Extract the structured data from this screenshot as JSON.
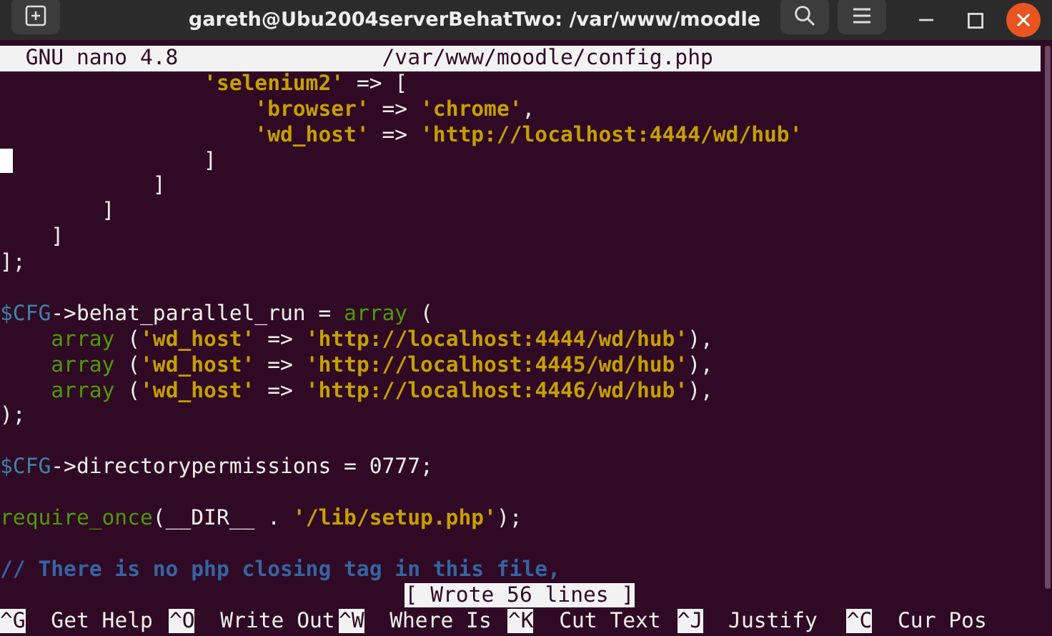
{
  "window": {
    "title": "gareth@Ubu2004serverBehatTwo: /var/www/moodle"
  },
  "nano_header": {
    "app": "GNU nano 4.8",
    "file": "/var/www/moodle/config.php"
  },
  "lines": [
    {
      "kind": "code",
      "cursor": false,
      "tokens": [
        {
          "text": "                'selenium2'",
          "kind": "string"
        },
        {
          "text": " => [",
          "kind": "plain"
        }
      ]
    },
    {
      "kind": "code",
      "cursor": false,
      "tokens": [
        {
          "text": "                    'browser'",
          "kind": "string"
        },
        {
          "text": " => ",
          "kind": "plain"
        },
        {
          "text": "'chrome'",
          "kind": "string"
        },
        {
          "text": ",",
          "kind": "plain"
        }
      ]
    },
    {
      "kind": "code",
      "cursor": false,
      "tokens": [
        {
          "text": "                    'wd_host'",
          "kind": "string"
        },
        {
          "text": " => ",
          "kind": "plain"
        },
        {
          "text": "'http://localhost:4444/wd/hub'",
          "kind": "string"
        }
      ]
    },
    {
      "kind": "code",
      "cursor": true,
      "tokens": [
        {
          "text": "                ]",
          "kind": "plain"
        }
      ]
    },
    {
      "kind": "code",
      "cursor": false,
      "tokens": [
        {
          "text": "            ]",
          "kind": "plain"
        }
      ]
    },
    {
      "kind": "code",
      "cursor": false,
      "tokens": [
        {
          "text": "        ]",
          "kind": "plain"
        }
      ]
    },
    {
      "kind": "code",
      "cursor": false,
      "tokens": [
        {
          "text": "    ]",
          "kind": "plain"
        }
      ]
    },
    {
      "kind": "code",
      "cursor": false,
      "tokens": [
        {
          "text": "];",
          "kind": "plain"
        }
      ]
    },
    {
      "kind": "blank"
    },
    {
      "kind": "code",
      "cursor": false,
      "tokens": [
        {
          "text": "$CFG",
          "kind": "variable"
        },
        {
          "text": "->behat_parallel_run = ",
          "kind": "plain"
        },
        {
          "text": "array",
          "kind": "function"
        },
        {
          "text": " (",
          "kind": "plain"
        }
      ]
    },
    {
      "kind": "code",
      "cursor": false,
      "tokens": [
        {
          "text": "    array",
          "kind": "function"
        },
        {
          "text": " (",
          "kind": "plain"
        },
        {
          "text": "'wd_host'",
          "kind": "string"
        },
        {
          "text": " => ",
          "kind": "plain"
        },
        {
          "text": "'http://localhost:4444/wd/hub'",
          "kind": "string"
        },
        {
          "text": "),",
          "kind": "plain"
        }
      ]
    },
    {
      "kind": "code",
      "cursor": false,
      "tokens": [
        {
          "text": "    array",
          "kind": "function"
        },
        {
          "text": " (",
          "kind": "plain"
        },
        {
          "text": "'wd_host'",
          "kind": "string"
        },
        {
          "text": " => ",
          "kind": "plain"
        },
        {
          "text": "'http://localhost:4445/wd/hub'",
          "kind": "string"
        },
        {
          "text": "),",
          "kind": "plain"
        }
      ]
    },
    {
      "kind": "code",
      "cursor": false,
      "tokens": [
        {
          "text": "    array",
          "kind": "function"
        },
        {
          "text": " (",
          "kind": "plain"
        },
        {
          "text": "'wd_host'",
          "kind": "string"
        },
        {
          "text": " => ",
          "kind": "plain"
        },
        {
          "text": "'http://localhost:4446/wd/hub'",
          "kind": "string"
        },
        {
          "text": "),",
          "kind": "plain"
        }
      ]
    },
    {
      "kind": "code",
      "cursor": false,
      "tokens": [
        {
          "text": ");",
          "kind": "plain"
        }
      ]
    },
    {
      "kind": "blank"
    },
    {
      "kind": "code",
      "cursor": false,
      "tokens": [
        {
          "text": "$CFG",
          "kind": "variable"
        },
        {
          "text": "->directorypermissions = 0777;",
          "kind": "plain"
        }
      ]
    },
    {
      "kind": "blank"
    },
    {
      "kind": "code",
      "cursor": false,
      "tokens": [
        {
          "text": "require_once",
          "kind": "function"
        },
        {
          "text": "(__DIR__ . ",
          "kind": "plain"
        },
        {
          "text": "'/lib/setup.php'",
          "kind": "string"
        },
        {
          "text": ");",
          "kind": "plain"
        }
      ]
    },
    {
      "kind": "blank"
    },
    {
      "kind": "code",
      "cursor": false,
      "tokens": [
        {
          "text": "// There is no php closing tag in this file,",
          "kind": "comment"
        }
      ]
    }
  ],
  "status_message": "[ Wrote 56 lines ]",
  "shortcuts": [
    {
      "key": "^G",
      "label": "Get Help"
    },
    {
      "key": "^O",
      "label": "Write Out"
    },
    {
      "key": "^W",
      "label": "Where Is"
    },
    {
      "key": "^K",
      "label": "Cut Text"
    },
    {
      "key": "^J",
      "label": "Justify"
    },
    {
      "key": "^C",
      "label": "Cur Pos"
    }
  ]
}
